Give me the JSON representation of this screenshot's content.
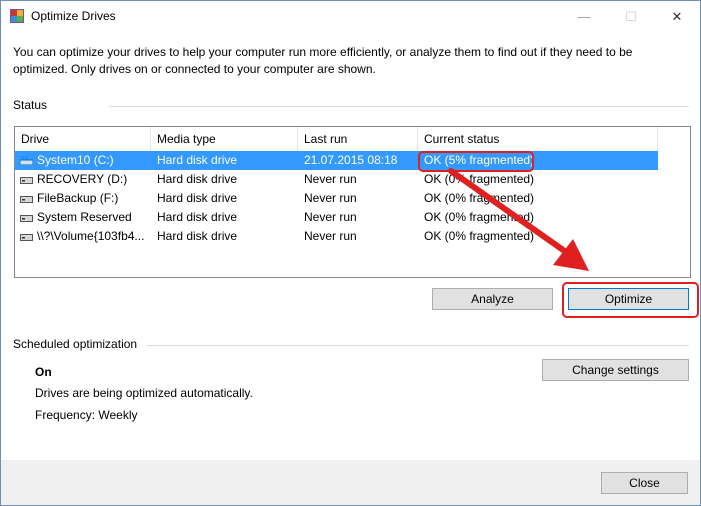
{
  "window": {
    "title": "Optimize Drives",
    "minimize_label": "—",
    "maximize_label": "☐",
    "close_label": "✕"
  },
  "intro_text": "You can optimize your drives to help your computer run more efficiently, or analyze them to find out if they need to be optimized. Only drives on or connected to your computer are shown.",
  "status": {
    "group_label": "Status",
    "columns": [
      "Drive",
      "Media type",
      "Last run",
      "Current status"
    ],
    "rows": [
      {
        "drive": "System10 (C:)",
        "media": "Hard disk drive",
        "last_run": "21.07.2015 08:18",
        "status": "OK (5% fragmented)",
        "icon": "windows-drive-icon",
        "selected": true
      },
      {
        "drive": "RECOVERY (D:)",
        "media": "Hard disk drive",
        "last_run": "Never run",
        "status": "OK (0% fragmented)",
        "icon": "drive-icon",
        "selected": false
      },
      {
        "drive": "FileBackup (F:)",
        "media": "Hard disk drive",
        "last_run": "Never run",
        "status": "OK (0% fragmented)",
        "icon": "drive-icon",
        "selected": false
      },
      {
        "drive": "System Reserved",
        "media": "Hard disk drive",
        "last_run": "Never run",
        "status": "OK (0% fragmented)",
        "icon": "drive-icon",
        "selected": false
      },
      {
        "drive": "\\\\?\\Volume{103fb4...",
        "media": "Hard disk drive",
        "last_run": "Never run",
        "status": "OK (0% fragmented)",
        "icon": "drive-icon",
        "selected": false
      }
    ]
  },
  "buttons": {
    "analyze": "Analyze",
    "optimize": "Optimize",
    "change_settings": "Change settings",
    "close": "Close"
  },
  "scheduled": {
    "group_label": "Scheduled optimization",
    "state": "On",
    "description": "Drives are being optimized automatically.",
    "frequency": "Frequency: Weekly"
  },
  "colors": {
    "selection": "#3399ff",
    "annotation": "#e02020",
    "button_face": "#e1e1e1"
  }
}
